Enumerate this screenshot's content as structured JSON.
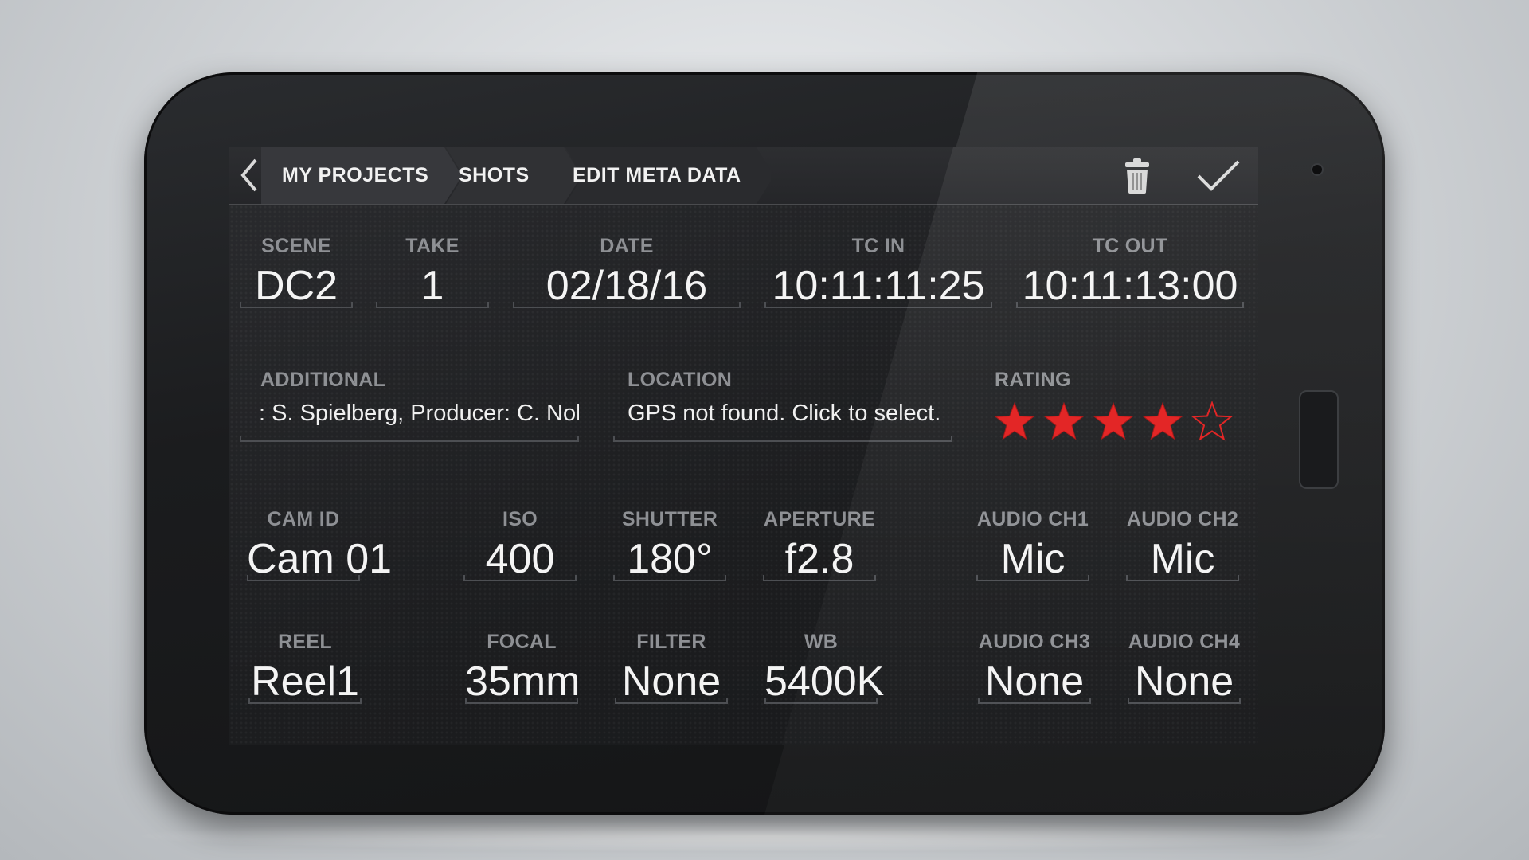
{
  "nav": {
    "back_icon": "chevron-left-icon",
    "breadcrumbs": [
      "MY PROJECTS",
      "SHOTS",
      "EDIT META DATA"
    ],
    "delete_icon": "trash-icon",
    "confirm_icon": "checkmark-icon"
  },
  "shot": {
    "scene": {
      "label": "SCENE",
      "value": "DC2"
    },
    "take": {
      "label": "TAKE",
      "value": "1"
    },
    "date": {
      "label": "DATE",
      "value": "02/18/16"
    },
    "tc_in": {
      "label": "TC IN",
      "value": "10:11:11:25"
    },
    "tc_out": {
      "label": "TC OUT",
      "value": "10:11:13:00"
    }
  },
  "additional": {
    "label": "ADDITIONAL",
    "value": ": S. Spielberg, Producer: C. Nolan"
  },
  "location": {
    "label": "LOCATION",
    "value": "GPS not found. Click to select."
  },
  "rating": {
    "label": "RATING",
    "value": 4,
    "max": 5,
    "color": "#e21b1b"
  },
  "camera": {
    "cam_id": {
      "label": "CAM ID",
      "value": "Cam 01"
    },
    "iso": {
      "label": "ISO",
      "value": "400"
    },
    "shutter": {
      "label": "SHUTTER",
      "value": "180°"
    },
    "aperture": {
      "label": "APERTURE",
      "value": "f2.8"
    },
    "reel": {
      "label": "REEL",
      "value": "Reel1"
    },
    "focal": {
      "label": "FOCAL",
      "value": "35mm"
    },
    "filter": {
      "label": "FILTER",
      "value": "None"
    },
    "wb": {
      "label": "WB",
      "value": "5400K"
    }
  },
  "audio": {
    "ch1": {
      "label": "AUDIO CH1",
      "value": "Mic"
    },
    "ch2": {
      "label": "AUDIO CH2",
      "value": "Mic"
    },
    "ch3": {
      "label": "AUDIO CH3",
      "value": "None"
    },
    "ch4": {
      "label": "AUDIO CH4",
      "value": "None"
    }
  }
}
